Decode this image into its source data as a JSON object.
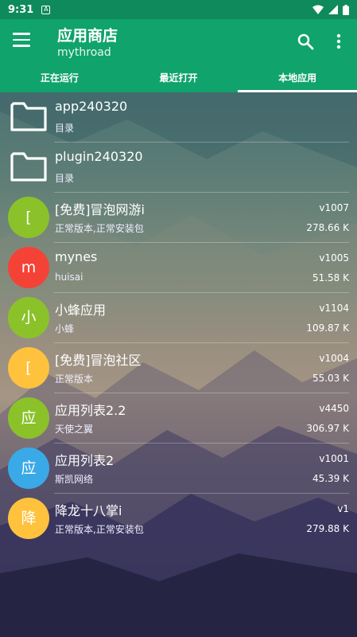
{
  "statusbar": {
    "time": "9:31",
    "notification_icon": "A",
    "icons": [
      "wifi-icon",
      "signal-icon",
      "battery-icon"
    ]
  },
  "appbar": {
    "title": "应用商店",
    "subtitle": "mythroad",
    "icons": [
      "menu-icon",
      "search-icon",
      "more-vert-icon"
    ],
    "color": "#10a36c"
  },
  "tabs": [
    {
      "label": "正在运行",
      "active": false
    },
    {
      "label": "最近打开",
      "active": false
    },
    {
      "label": "本地应用",
      "active": true
    }
  ],
  "list": {
    "folders": [
      {
        "name": "app240320",
        "desc": "目录"
      },
      {
        "name": "plugin240320",
        "desc": "目录"
      }
    ],
    "apps": [
      {
        "initial": "[",
        "color": "#8bc22a",
        "name": "[免费]冒泡网游i",
        "desc": "正常版本,正常安装包",
        "version": "v1007",
        "size": "278.66 K"
      },
      {
        "initial": "m",
        "color": "#f44336",
        "name": "mynes",
        "desc": "huisai",
        "version": "v1005",
        "size": "51.58 K"
      },
      {
        "initial": "小",
        "color": "#8bc22a",
        "name": "小蜂应用",
        "desc": "小蜂",
        "version": "v1104",
        "size": "109.87 K"
      },
      {
        "initial": "[",
        "color": "#ffc23d",
        "name": "[免费]冒泡社区",
        "desc": "正常版本",
        "version": "v1004",
        "size": "55.03 K"
      },
      {
        "initial": "应",
        "color": "#8bc22a",
        "name": "应用列表2.2",
        "desc": "天使之翼",
        "version": "v4450",
        "size": "306.97 K"
      },
      {
        "initial": "应",
        "color": "#3aa9e8",
        "name": "应用列表2",
        "desc": "斯凯网络",
        "version": "v1001",
        "size": "45.39 K"
      },
      {
        "initial": "降",
        "color": "#ffc23d",
        "name": "降龙十八掌i",
        "desc": "正常版本,正常安装包",
        "version": "v1",
        "size": "279.88 K"
      }
    ]
  }
}
